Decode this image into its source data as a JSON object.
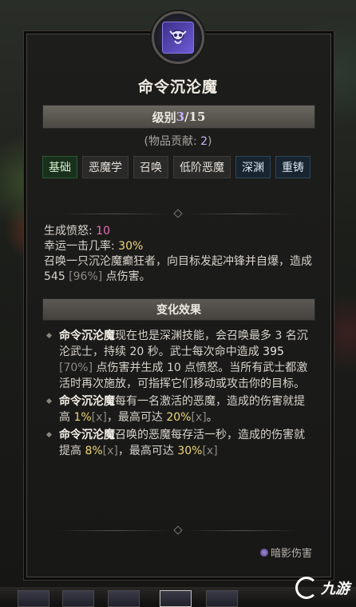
{
  "skill": {
    "icon": "demon-skull-icon",
    "title": "命令沉沦魔",
    "level_prefix": "级别",
    "level_current": "3",
    "level_max": "/15",
    "contrib_prefix": "(物品贡献: ",
    "contrib_value": "2",
    "contrib_suffix": ")"
  },
  "tags": [
    {
      "label": "基础",
      "style": "green"
    },
    {
      "label": "恶魔学",
      "style": "normal"
    },
    {
      "label": "召唤",
      "style": "normal"
    },
    {
      "label": "低阶恶魔",
      "style": "normal"
    },
    {
      "label": "深渊",
      "style": "blue"
    },
    {
      "label": "重铸",
      "style": "blue"
    }
  ],
  "stats": {
    "fury_label": "生成愤怒: ",
    "fury_value": "10",
    "crit_label": "幸运一击几率: ",
    "crit_value": "30%",
    "desc_1": "召唤一只沉沦魔癫狂者，向目标发起冲锋并自爆，造成 ",
    "desc_dmg": "545",
    "desc_pct": " [96%]",
    "desc_2": " 点伤害。"
  },
  "section_title": "变化效果",
  "effects": {
    "e1_name": "命令沉沦魔",
    "e1_a": "现在也是深渊技能，会召唤最多 3 名沉沦武士，持续 20 秒。武士每次命中造成 ",
    "e1_dmg": "395",
    "e1_pct": " [70%]",
    "e1_b": " 点伤害并生成 10 点愤怒。当所有武士都激活时再次施放，可指挥它们移动或攻击你的目标。",
    "e2_name": "命令沉沦魔",
    "e2_a": "每有一名激活的恶魔，造成的伤害就提高 ",
    "e2_v1": "1%",
    "e2_x1": "[x]",
    "e2_b": "，最高可达 ",
    "e2_v2": "20%",
    "e2_x2": "[x]",
    "e2_c": "。",
    "e3_name": "命令沉沦魔",
    "e3_a": "召唤的恶魔每存活一秒，造成的伤害就提高 ",
    "e3_v1": "8%",
    "e3_x1": "[x]",
    "e3_b": "，最高可达 ",
    "e3_v2": "30%",
    "e3_x2": "[x]"
  },
  "damage_type": "暗影伤害",
  "watermark": "九游",
  "colors": {
    "accent_purple": "#c9b3ff",
    "fury_pink": "#e870b0",
    "value_yellow": "#f0d878"
  }
}
